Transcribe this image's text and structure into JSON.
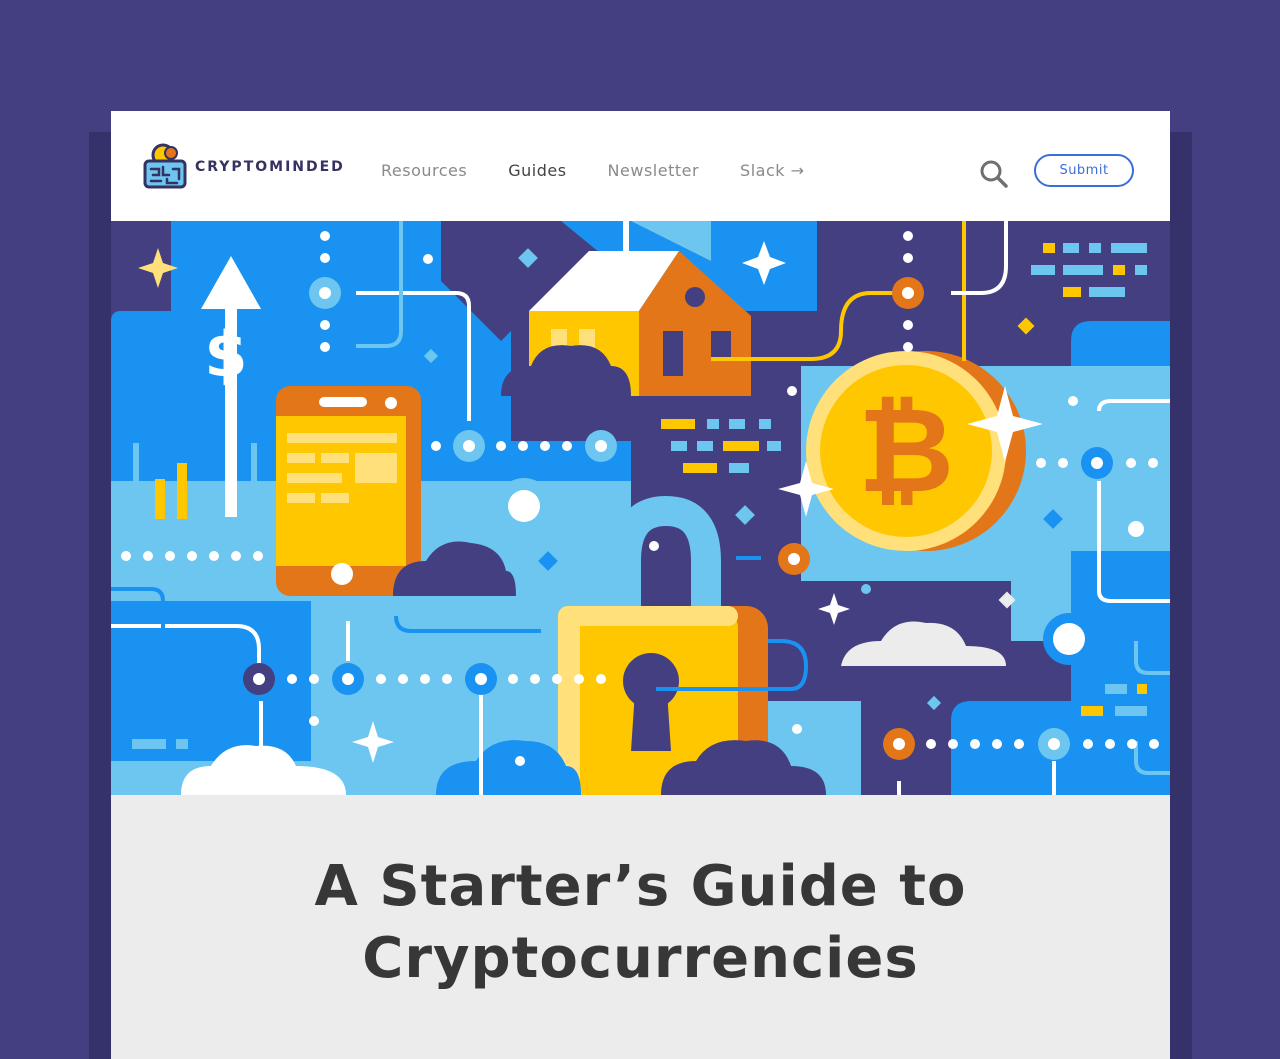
{
  "brand": {
    "name": "CRYPTOMINDED",
    "logo_icon": "brain-coin-icon"
  },
  "nav": {
    "items": [
      {
        "label": "Resources",
        "active": false
      },
      {
        "label": "Guides",
        "active": true
      },
      {
        "label": "Newsletter",
        "active": false
      },
      {
        "label": "Slack →",
        "active": false
      }
    ]
  },
  "header": {
    "search_icon": "search-icon",
    "submit_label": "Submit"
  },
  "hero": {
    "illustration": "crypto-network-illustration"
  },
  "article": {
    "title_line1": "A Starter’s Guide to",
    "title_line2": "Cryptocurrencies"
  },
  "colors": {
    "page_bg": "#433f80",
    "accent_blue": "#3a6fd8",
    "hero_dark": "#433f80",
    "hero_blue": "#1a92f1",
    "hero_light_blue": "#6cc6ef",
    "yellow": "#ffc700",
    "orange": "#e27619"
  }
}
